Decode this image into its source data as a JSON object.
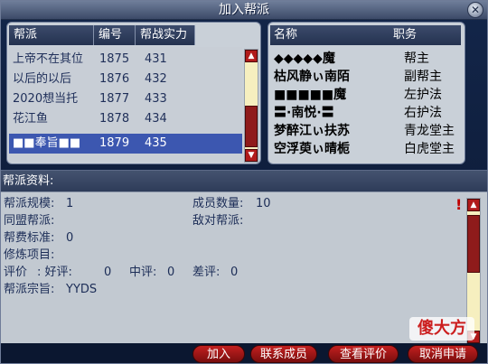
{
  "window": {
    "title": "加入帮派",
    "close_label": "✕"
  },
  "gang_list": {
    "headers": [
      "帮派",
      "编号",
      "帮战实力"
    ],
    "rows": [
      {
        "name": "上帝不在其位",
        "id": "1875",
        "power": "431"
      },
      {
        "name": "以后的以后",
        "id": "1876",
        "power": "432"
      },
      {
        "name": "2020想当托",
        "id": "1877",
        "power": "433"
      },
      {
        "name": "花江鱼",
        "id": "1878",
        "power": "434"
      },
      {
        "name": "■■奉旨■■",
        "id": "1879",
        "power": "435",
        "selected": true
      }
    ]
  },
  "members": {
    "headers": [
      "名称",
      "职务"
    ],
    "rows": [
      {
        "name": "◆◆◆◆◆魔",
        "role": "帮主"
      },
      {
        "name": "枯风静ぃ南陌",
        "role": "副帮主"
      },
      {
        "name": "■■■■■魔",
        "role": "左护法"
      },
      {
        "name": "〓·南悦·〓",
        "role": "右护法"
      },
      {
        "name": "梦醉江ぃ扶苏",
        "role": "青龙堂主"
      },
      {
        "name": "空浮萸ぃ晴栀",
        "role": "白虎堂主"
      }
    ]
  },
  "info": {
    "title": "帮派资料:",
    "scale_label": "帮派规模:",
    "scale_value": "1",
    "members_label": "成员数量:",
    "members_value": "10",
    "ally_label": "同盟帮派:",
    "enemy_label": "敌对帮派:",
    "fee_label": "帮费标准:",
    "fee_value": "0",
    "cultivation_label": "修炼项目:",
    "rating_label": "评价",
    "good_label": ":  好评:",
    "good_value": "0",
    "mid_label": "中评:",
    "mid_value": "0",
    "bad_label": "差评:",
    "bad_value": "0",
    "motto_label": "帮派宗旨:",
    "motto_value": "YYDS"
  },
  "buttons": {
    "join": "加入",
    "contact": "联系成员",
    "reviews": "查看评价",
    "cancel": "取消申请"
  },
  "watermark": "傻大方",
  "colors": {
    "accent_red": "#b11a1a",
    "selection": "#3c57b0",
    "panel": "#c8ced6"
  }
}
